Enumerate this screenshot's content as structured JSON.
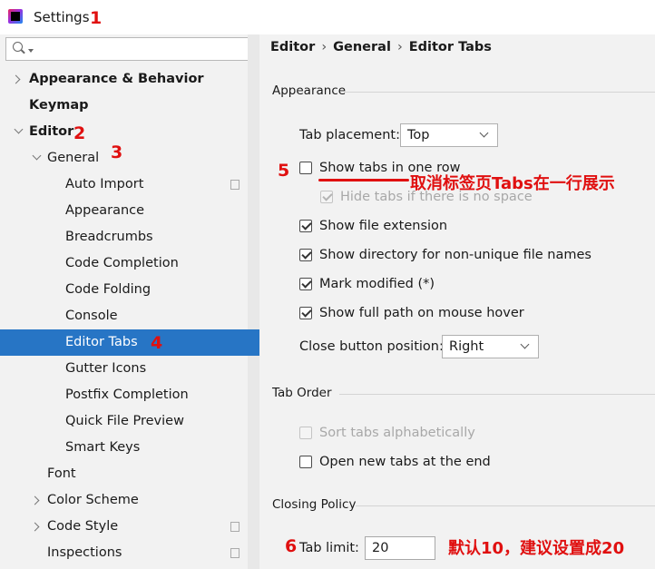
{
  "window": {
    "title": "Settings"
  },
  "search": {
    "value": ""
  },
  "sidebar": {
    "items": [
      {
        "label": "Appearance & Behavior"
      },
      {
        "label": "Keymap"
      },
      {
        "label": "Editor"
      },
      {
        "label": "General"
      },
      {
        "label": "Auto Import"
      },
      {
        "label": "Appearance"
      },
      {
        "label": "Breadcrumbs"
      },
      {
        "label": "Code Completion"
      },
      {
        "label": "Code Folding"
      },
      {
        "label": "Console"
      },
      {
        "label": "Editor Tabs"
      },
      {
        "label": "Gutter Icons"
      },
      {
        "label": "Postfix Completion"
      },
      {
        "label": "Quick File Preview"
      },
      {
        "label": "Smart Keys"
      },
      {
        "label": "Font"
      },
      {
        "label": "Color Scheme"
      },
      {
        "label": "Code Style"
      },
      {
        "label": "Inspections"
      }
    ]
  },
  "breadcrumb": {
    "part1": "Editor",
    "part2": "General",
    "part3": "Editor Tabs",
    "separator": "›"
  },
  "appearance": {
    "title": "Appearance",
    "tab_placement_label": "Tab placement:",
    "tab_placement_value": "Top",
    "show_tabs_one_row": "Show tabs in one row",
    "hide_tabs_no_space": "Hide tabs if there is no space",
    "show_file_extension": "Show file extension",
    "show_directory": "Show directory for non-unique file names",
    "mark_modified": "Mark modified (*)",
    "show_full_path": "Show full path on mouse hover",
    "close_button_label": "Close button position:",
    "close_button_value": "Right"
  },
  "tab_order": {
    "title": "Tab Order",
    "sort_alpha": "Sort tabs alphabetically",
    "open_at_end": "Open new tabs at the end"
  },
  "closing_policy": {
    "title": "Closing Policy",
    "tab_limit_label": "Tab limit:",
    "tab_limit_value": "20"
  },
  "annotations": {
    "n1": "1",
    "n2": "2",
    "n3": "3",
    "n4": "4",
    "n5": "5",
    "n6": "6",
    "note_tabs": "取消标签页Tabs在一行展示",
    "note_limit": "默认10，建议设置成20"
  },
  "colors": {
    "selection": "#2775c5",
    "annotation": "#e01010"
  }
}
